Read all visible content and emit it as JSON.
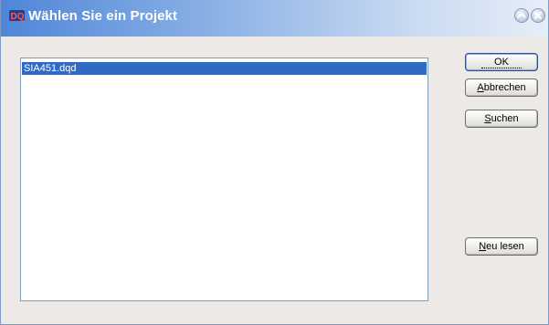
{
  "window": {
    "title": "Wählen Sie ein Projekt",
    "app_icon": "dq-app-icon",
    "controls": {
      "collapse_icon": "chevron-up-icon",
      "close_icon": "close-icon"
    }
  },
  "project_list": {
    "items": [
      {
        "label": "SIA451.dqd",
        "selected": true
      }
    ]
  },
  "buttons": {
    "ok": {
      "label": "OK",
      "default": true
    },
    "cancel": {
      "label_accel": "A",
      "label_rest": "bbrechen"
    },
    "search": {
      "label_accel": "S",
      "label_rest": "uchen"
    },
    "reload": {
      "label_accel": "N",
      "label_rest": "eu lesen"
    }
  },
  "colors": {
    "selection": "#316ac5",
    "titlebar_start": "#4f86d8",
    "titlebar_end": "#e6eef8",
    "dialog_background": "#ece9e6"
  }
}
